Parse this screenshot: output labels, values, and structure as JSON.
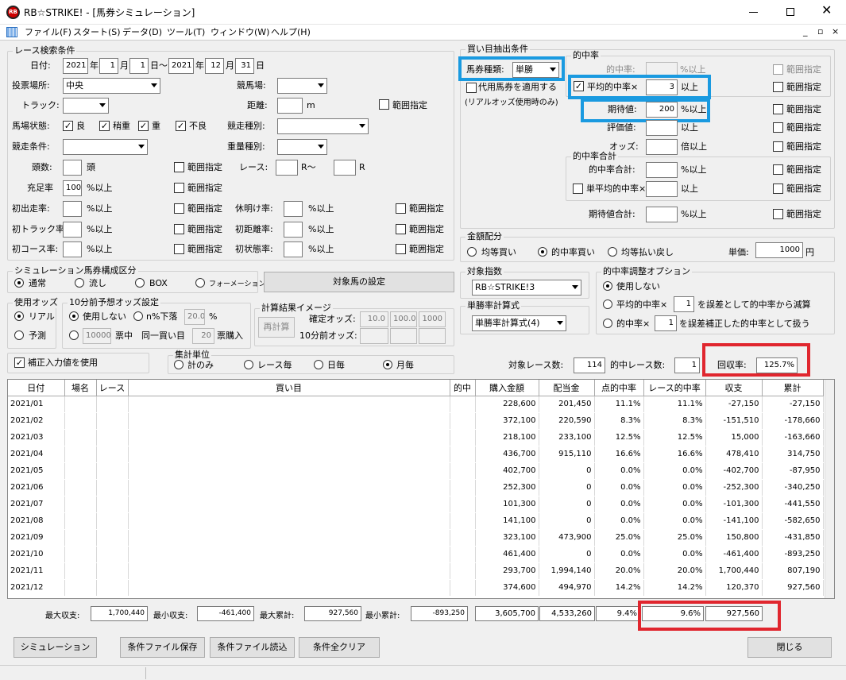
{
  "window": {
    "title": "RB☆STRIKE! - [馬券シミュレーション]",
    "logo": "RB"
  },
  "menu": [
    "ファイル(F)",
    "スタート(S)",
    "データ(D)",
    "ツール(T)",
    "ウィンドウ(W)",
    "ヘルプ(H)"
  ],
  "race": {
    "group": "レース検索条件",
    "date_label": "日付:",
    "y1": "2021",
    "m1": "1",
    "d1": "1",
    "y2": "2021",
    "m2": "12",
    "d2": "31",
    "year": "年",
    "month": "月",
    "day": "日",
    "tilde": "日～",
    "venue_label": "投票場所:",
    "venue": "中央",
    "course_label": "競馬場:",
    "track_label": "トラック:",
    "dist_label": "距離:",
    "dist_unit": "m",
    "range": "範囲指定",
    "cond_label": "馬場状態:",
    "good": "良",
    "slightly": "稍重",
    "heavy": "重",
    "bad": "不良",
    "type_label": "競走種別:",
    "racecond_label": "競走条件:",
    "weight_label": "重量種別:",
    "heads_label": "頭数:",
    "heads_unit": "頭",
    "race_label": "レース:",
    "r_to": "R～",
    "r": "R",
    "fill_label": "充足率",
    "fill_val": "100",
    "pct_over": "%以上",
    "first_label": "初出走率:",
    "rest_label": "休明け率:",
    "firsttrack_label": "初トラック率:",
    "firstdist_label": "初距離率:",
    "firstcourse_label": "初コース率:",
    "firststate_label": "初状態率:"
  },
  "sim": {
    "group": "シミュレーション馬券構成区分",
    "opts": [
      "通常",
      "流し",
      "BOX",
      "フォーメーション"
    ],
    "target_btn": "対象馬の設定"
  },
  "odds": {
    "group": "使用オッズ",
    "real": "リアル",
    "forecast": "予測"
  },
  "pre": {
    "group": "10分前予想オッズ設定",
    "none": "使用しない",
    "drop": "n%下落",
    "drop_val": "20.0",
    "pct": "%",
    "tickets": "10000",
    "tickets_label": "票中",
    "same": "同一買い目",
    "same_val": "20",
    "buy": "票購入"
  },
  "calc": {
    "group": "計算結果イメージ",
    "recalc": "再計算",
    "fixed_label": "確定オッズ:",
    "pre_label": "10分前オッズ:",
    "v1": "10.0",
    "v2": "100.0",
    "v3": "1000"
  },
  "correct": {
    "label": "補正入力値を使用"
  },
  "agg": {
    "group": "集計単位",
    "opts": [
      "計のみ",
      "レース毎",
      "日毎",
      "月毎"
    ]
  },
  "buy": {
    "group": "買い目抽出条件",
    "type_label": "馬券種類:",
    "type": "単勝",
    "proxy": "代用馬券を適用する",
    "proxy2": "(リアルオッズ使用時のみ)"
  },
  "hit": {
    "group": "的中率",
    "rate_label": "的中率:",
    "over": "以上",
    "pct_over": "%以上",
    "avg_label": "平均的中率×",
    "avg_val": "3",
    "exp_label": "期待値:",
    "exp_val": "200",
    "eval_label": "評価値:",
    "odds_label": "オッズ:",
    "odds_over": "倍以上",
    "sub": "的中率合計",
    "sum_label": "的中率合計:",
    "single_label": "単平均的中率×",
    "expsum_label": "期待値合計:",
    "range": "範囲指定"
  },
  "money": {
    "group": "金額配分",
    "opts": [
      "均等買い",
      "的中率買い",
      "均等払い戻し"
    ],
    "unit_label": "単価:",
    "unit_val": "1000",
    "yen": "円"
  },
  "target": {
    "group": "対象指数",
    "val": "RB☆STRIKE!3"
  },
  "formula": {
    "group": "単勝率計算式",
    "val": "単勝率計算式(4)"
  },
  "adj": {
    "group": "的中率調整オプション",
    "none": "使用しない",
    "avg1": "平均的中率×",
    "avg1_val": "1",
    "avg1_txt": "を誤差として的中率から減算",
    "avg2": "的中率×",
    "avg2_val": "1",
    "avg2_txt": "を誤差補正した的中率として扱う"
  },
  "summary": {
    "races_label": "対象レース数:",
    "races": "114",
    "hits_label": "的中レース数:",
    "hits": "1",
    "return_label": "回収率:",
    "return": "125.7%"
  },
  "table": {
    "headers": [
      "日付",
      "場名",
      "レース",
      "買い目",
      "的中",
      "購入金額",
      "配当金",
      "点的中率",
      "レース的中率",
      "収支",
      "累計"
    ],
    "rows": [
      [
        "2021/01",
        "",
        "",
        "",
        "",
        "228,600",
        "201,450",
        "11.1%",
        "11.1%",
        "-27,150",
        "-27,150"
      ],
      [
        "2021/02",
        "",
        "",
        "",
        "",
        "372,100",
        "220,590",
        "8.3%",
        "8.3%",
        "-151,510",
        "-178,660"
      ],
      [
        "2021/03",
        "",
        "",
        "",
        "",
        "218,100",
        "233,100",
        "12.5%",
        "12.5%",
        "15,000",
        "-163,660"
      ],
      [
        "2021/04",
        "",
        "",
        "",
        "",
        "436,700",
        "915,110",
        "16.6%",
        "16.6%",
        "478,410",
        "314,750"
      ],
      [
        "2021/05",
        "",
        "",
        "",
        "",
        "402,700",
        "0",
        "0.0%",
        "0.0%",
        "-402,700",
        "-87,950"
      ],
      [
        "2021/06",
        "",
        "",
        "",
        "",
        "252,300",
        "0",
        "0.0%",
        "0.0%",
        "-252,300",
        "-340,250"
      ],
      [
        "2021/07",
        "",
        "",
        "",
        "",
        "101,300",
        "0",
        "0.0%",
        "0.0%",
        "-101,300",
        "-441,550"
      ],
      [
        "2021/08",
        "",
        "",
        "",
        "",
        "141,100",
        "0",
        "0.0%",
        "0.0%",
        "-141,100",
        "-582,650"
      ],
      [
        "2021/09",
        "",
        "",
        "",
        "",
        "323,100",
        "473,900",
        "25.0%",
        "25.0%",
        "150,800",
        "-431,850"
      ],
      [
        "2021/10",
        "",
        "",
        "",
        "",
        "461,400",
        "0",
        "0.0%",
        "0.0%",
        "-461,400",
        "-893,250"
      ],
      [
        "2021/11",
        "",
        "",
        "",
        "",
        "293,700",
        "1,994,140",
        "20.0%",
        "20.0%",
        "1,700,440",
        "807,190"
      ],
      [
        "2021/12",
        "",
        "",
        "",
        "",
        "374,600",
        "494,970",
        "14.2%",
        "14.2%",
        "120,370",
        "927,560"
      ]
    ]
  },
  "footer": {
    "maxbal_label": "最大収支:",
    "maxbal": "1,700,440",
    "minbal_label": "最小収支:",
    "minbal": "-461,400",
    "maxcum_label": "最大累計:",
    "maxcum": "927,560",
    "mincum_label": "最小累計:",
    "mincum": "-893,250",
    "total_buy": "3,605,700",
    "total_pay": "4,533,260",
    "hit": "9.4%",
    "race_hit": "9.6%",
    "total": "927,560"
  },
  "buttons": {
    "simulate": "シミュレーション",
    "save": "条件ファイル保存",
    "load": "条件ファイル読込",
    "clear": "条件全クリア",
    "close": "閉じる"
  }
}
